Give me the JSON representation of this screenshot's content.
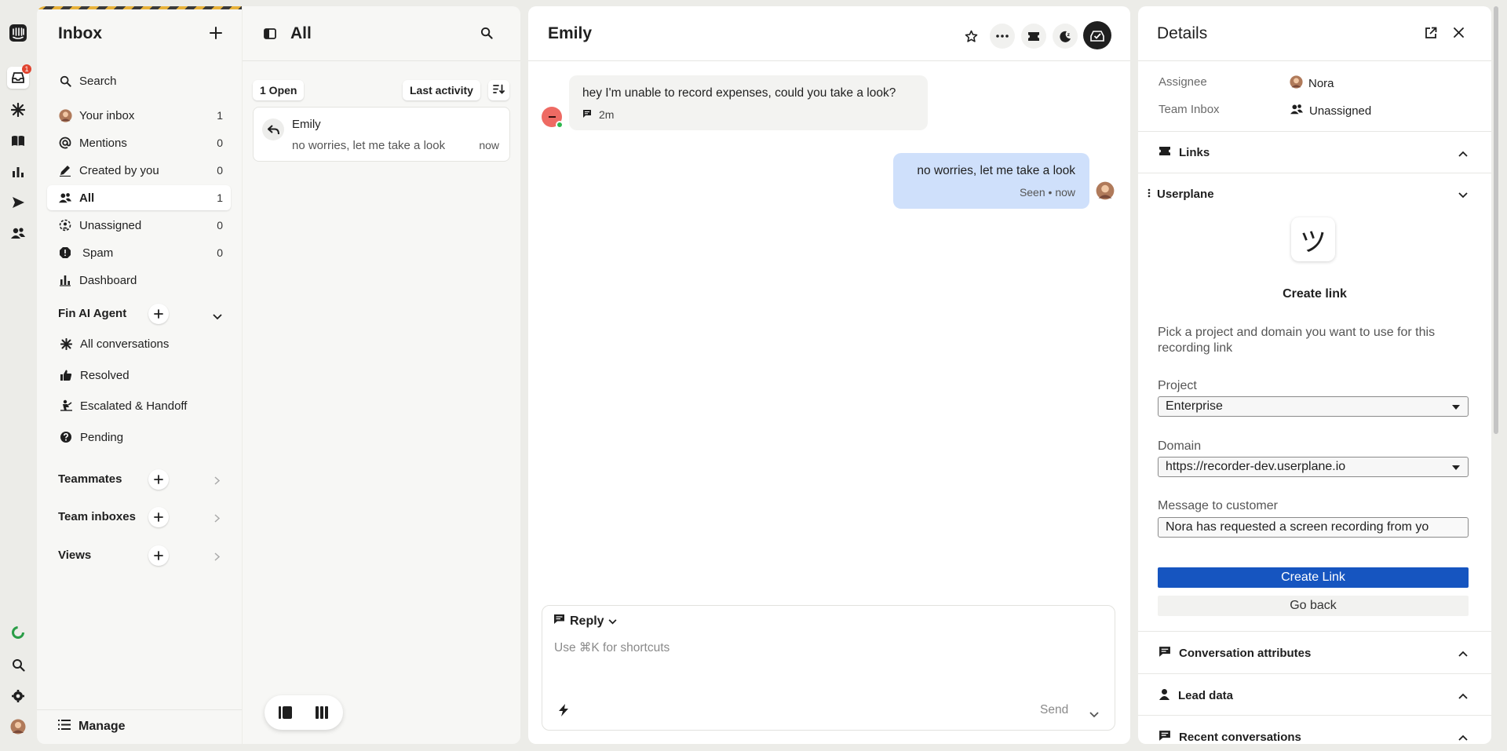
{
  "rail": {
    "badge": "1",
    "items": [
      {
        "name": "logo-icon"
      },
      {
        "name": "inbox-icon"
      },
      {
        "name": "fin-icon"
      },
      {
        "name": "knowledge-icon"
      },
      {
        "name": "reports-icon"
      },
      {
        "name": "outbound-icon"
      },
      {
        "name": "contacts-icon"
      },
      {
        "name": "status-icon"
      },
      {
        "name": "search-icon"
      },
      {
        "name": "settings-icon"
      },
      {
        "name": "avatar"
      }
    ]
  },
  "nav": {
    "title": "Inbox",
    "search_label": "Search",
    "items": [
      {
        "label": "Your inbox",
        "count": "1"
      },
      {
        "label": "Mentions",
        "count": "0"
      },
      {
        "label": "Created by you",
        "count": "0"
      },
      {
        "label": "All",
        "count": "1"
      },
      {
        "label": "Unassigned",
        "count": "0"
      },
      {
        "label": "Spam",
        "count": "0"
      },
      {
        "label": "Dashboard",
        "count": ""
      }
    ],
    "fin_section": "Fin AI Agent",
    "fin_items": [
      {
        "label": "All conversations"
      },
      {
        "label": "Resolved"
      },
      {
        "label": "Escalated & Handoff"
      },
      {
        "label": "Pending"
      }
    ],
    "teammates": "Teammates",
    "team_inboxes": "Team inboxes",
    "views": "Views",
    "manage": "Manage"
  },
  "list": {
    "title": "All",
    "open_filter": "1 Open",
    "sort_label": "Last activity",
    "conversation": {
      "name": "Emily",
      "preview": "no worries, let me take a look",
      "time": "now"
    }
  },
  "chat": {
    "title": "Emily",
    "messages": [
      {
        "text": "hey I'm unable to record expenses, could you take a look?",
        "meta": "2m"
      },
      {
        "text": "no worries, let me take a look",
        "meta": "Seen • now"
      }
    ],
    "composer": {
      "mode": "Reply",
      "placeholder": "Use ⌘K for shortcuts",
      "send": "Send"
    }
  },
  "details": {
    "title": "Details",
    "assignee_label": "Assignee",
    "assignee_value": "Nora",
    "team_inbox_label": "Team Inbox",
    "team_inbox_value": "Unassigned",
    "links_section": "Links",
    "userplane_section": "Userplane",
    "userplane_logo": "ツ",
    "create_link_title": "Create link",
    "create_link_desc": "Pick a project and domain you want to use for this recording link",
    "project_label": "Project",
    "project_value": "Enterprise",
    "domain_label": "Domain",
    "domain_value": "https://recorder-dev.userplane.io",
    "message_label": "Message to customer",
    "message_value": "Nora has requested a screen recording from yo",
    "create_button": "Create Link",
    "back_button": "Go back",
    "conv_attributes": "Conversation attributes",
    "lead_data": "Lead data",
    "recent_conversations": "Recent conversations"
  },
  "colors": {
    "primary": "#1655c0",
    "bubble_out": "#cfe0fb",
    "badge": "#e0442f",
    "online": "#2eb84f"
  }
}
